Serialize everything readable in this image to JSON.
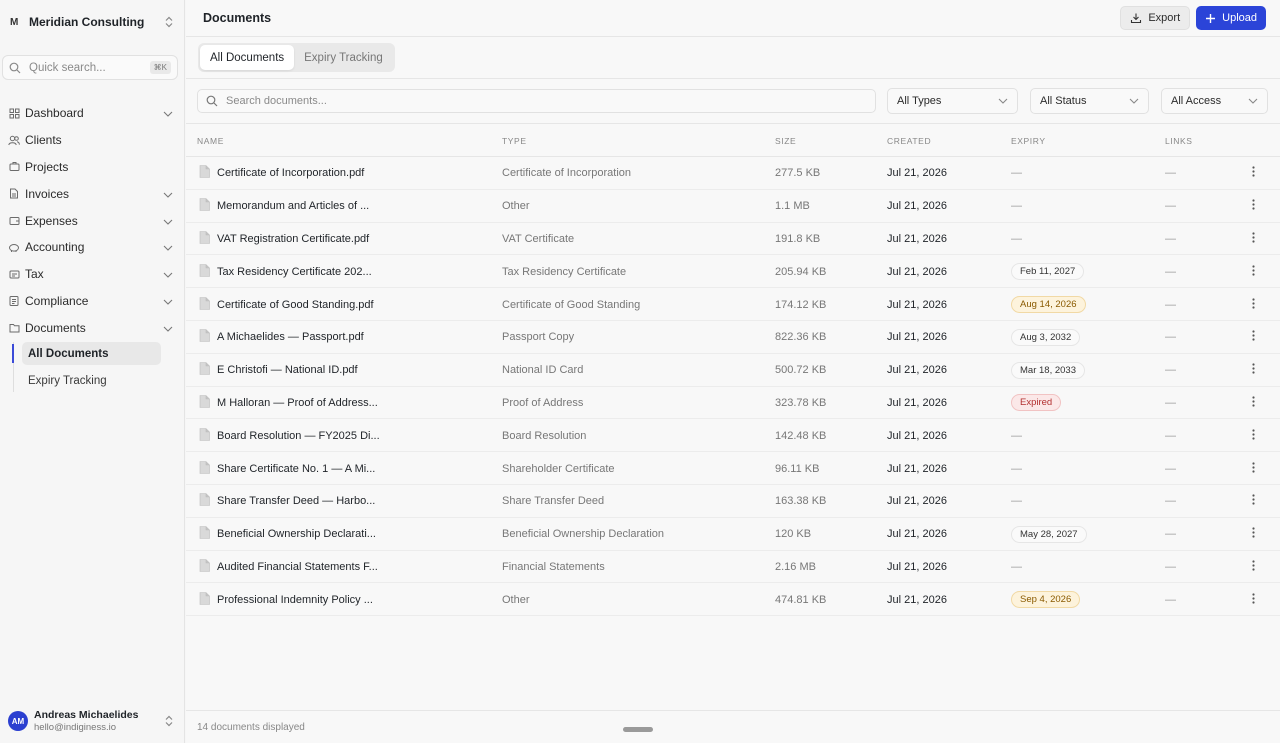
{
  "org": {
    "logo": "M",
    "name": "Meridian Consulting"
  },
  "quick_search": {
    "placeholder": "Quick search...",
    "shortcut": "⌘K"
  },
  "nav": {
    "items": [
      {
        "label": "Dashboard",
        "icon": "dashboard-grid-icon",
        "has_chevron": true
      },
      {
        "label": "Clients",
        "icon": "users-icon",
        "has_chevron": false
      },
      {
        "label": "Projects",
        "icon": "briefcase-icon",
        "has_chevron": false
      },
      {
        "label": "Invoices",
        "icon": "file-icon",
        "has_chevron": true
      },
      {
        "label": "Expenses",
        "icon": "wallet-icon",
        "has_chevron": true
      },
      {
        "label": "Accounting",
        "icon": "piggy-bank-icon",
        "has_chevron": true
      },
      {
        "label": "Tax",
        "icon": "receipt-icon",
        "has_chevron": true
      },
      {
        "label": "Compliance",
        "icon": "clipboard-icon",
        "has_chevron": true
      },
      {
        "label": "Documents",
        "icon": "folder-icon",
        "has_chevron": true
      }
    ],
    "documents_sub": [
      {
        "label": "All Documents",
        "active": true
      },
      {
        "label": "Expiry Tracking",
        "active": false
      }
    ]
  },
  "user": {
    "initials": "AM",
    "name": "Andreas Michaelides",
    "email": "hello@indiginess.io"
  },
  "header": {
    "title": "Documents",
    "export_label": "Export",
    "upload_label": "Upload"
  },
  "tabs": [
    {
      "label": "All Documents",
      "active": true
    },
    {
      "label": "Expiry Tracking",
      "active": false
    }
  ],
  "filters": {
    "search_placeholder": "Search documents...",
    "type": "All Types",
    "status": "All Status",
    "access": "All Access"
  },
  "columns": {
    "name": "NAME",
    "type": "TYPE",
    "size": "SIZE",
    "created": "CREATED",
    "expiry": "EXPIRY",
    "links": "LINKS"
  },
  "documents": [
    {
      "name": "Certificate of Incorporation.pdf",
      "type": "Certificate of Incorporation",
      "size": "277.5 KB",
      "created": "Jul 21, 2026",
      "expiry": "—",
      "expiry_style": "none",
      "links": "—"
    },
    {
      "name": "Memorandum and Articles of ...",
      "type": "Other",
      "size": "1.1 MB",
      "created": "Jul 21, 2026",
      "expiry": "—",
      "expiry_style": "none",
      "links": "—"
    },
    {
      "name": "VAT Registration Certificate.pdf",
      "type": "VAT Certificate",
      "size": "191.8 KB",
      "created": "Jul 21, 2026",
      "expiry": "—",
      "expiry_style": "none",
      "links": "—"
    },
    {
      "name": "Tax Residency Certificate 202...",
      "type": "Tax Residency Certificate",
      "size": "205.94 KB",
      "created": "Jul 21, 2026",
      "expiry": "Feb 11, 2027",
      "expiry_style": "normal",
      "links": "—"
    },
    {
      "name": "Certificate of Good Standing.pdf",
      "type": "Certificate of Good Standing",
      "size": "174.12 KB",
      "created": "Jul 21, 2026",
      "expiry": "Aug 14, 2026",
      "expiry_style": "warn",
      "links": "—"
    },
    {
      "name": "A Michaelides — Passport.pdf",
      "type": "Passport Copy",
      "size": "822.36 KB",
      "created": "Jul 21, 2026",
      "expiry": "Aug 3, 2032",
      "expiry_style": "normal",
      "links": "—"
    },
    {
      "name": "E Christofi — National ID.pdf",
      "type": "National ID Card",
      "size": "500.72 KB",
      "created": "Jul 21, 2026",
      "expiry": "Mar 18, 2033",
      "expiry_style": "normal",
      "links": "—"
    },
    {
      "name": "M Halloran — Proof of Address...",
      "type": "Proof of Address",
      "size": "323.78 KB",
      "created": "Jul 21, 2026",
      "expiry": "Expired",
      "expiry_style": "expired",
      "links": "—"
    },
    {
      "name": "Board Resolution — FY2025 Di...",
      "type": "Board Resolution",
      "size": "142.48 KB",
      "created": "Jul 21, 2026",
      "expiry": "—",
      "expiry_style": "none",
      "links": "—"
    },
    {
      "name": "Share Certificate No. 1 — A Mi...",
      "type": "Shareholder Certificate",
      "size": "96.11 KB",
      "created": "Jul 21, 2026",
      "expiry": "—",
      "expiry_style": "none",
      "links": "—"
    },
    {
      "name": "Share Transfer Deed — Harbo...",
      "type": "Share Transfer Deed",
      "size": "163.38 KB",
      "created": "Jul 21, 2026",
      "expiry": "—",
      "expiry_style": "none",
      "links": "—"
    },
    {
      "name": "Beneficial Ownership Declarati...",
      "type": "Beneficial Ownership Declaration",
      "size": "120 KB",
      "created": "Jul 21, 2026",
      "expiry": "May 28, 2027",
      "expiry_style": "normal",
      "links": "—"
    },
    {
      "name": "Audited Financial Statements F...",
      "type": "Financial Statements",
      "size": "2.16 MB",
      "created": "Jul 21, 2026",
      "expiry": "—",
      "expiry_style": "none",
      "links": "—"
    },
    {
      "name": "Professional Indemnity Policy ...",
      "type": "Other",
      "size": "474.81 KB",
      "created": "Jul 21, 2026",
      "expiry": "Sep 4, 2026",
      "expiry_style": "warn",
      "links": "—"
    }
  ],
  "footer": {
    "count_text": "14 documents displayed"
  },
  "colors": {
    "accent": "#2b44d8",
    "warn_bg": "#fdf3dc",
    "expired_text": "#b23030"
  }
}
